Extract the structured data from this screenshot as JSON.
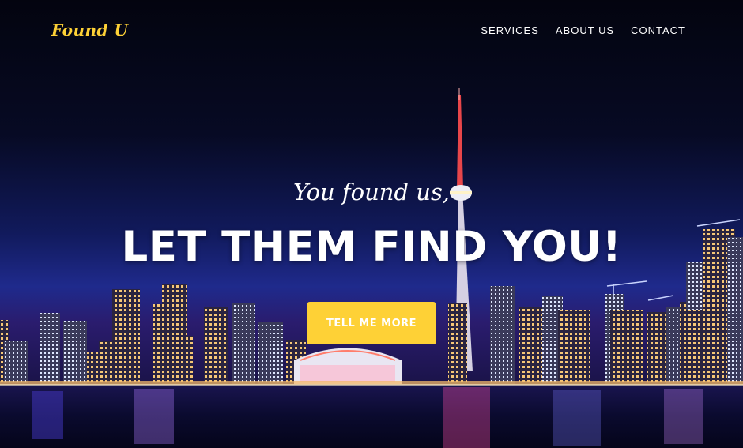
{
  "nav": {
    "brand": "Found U",
    "items": [
      {
        "label": "SERVICES"
      },
      {
        "label": "ABOUT US"
      },
      {
        "label": "CONTACT"
      }
    ]
  },
  "hero": {
    "subheading": "You found us,",
    "heading": "LET THEM FIND YOU!",
    "cta_label": "TELL ME MORE"
  },
  "colors": {
    "accent": "#fed136",
    "text": "#ffffff",
    "sky_top": "#03040f",
    "sky_horizon": "#1f2a8c"
  }
}
